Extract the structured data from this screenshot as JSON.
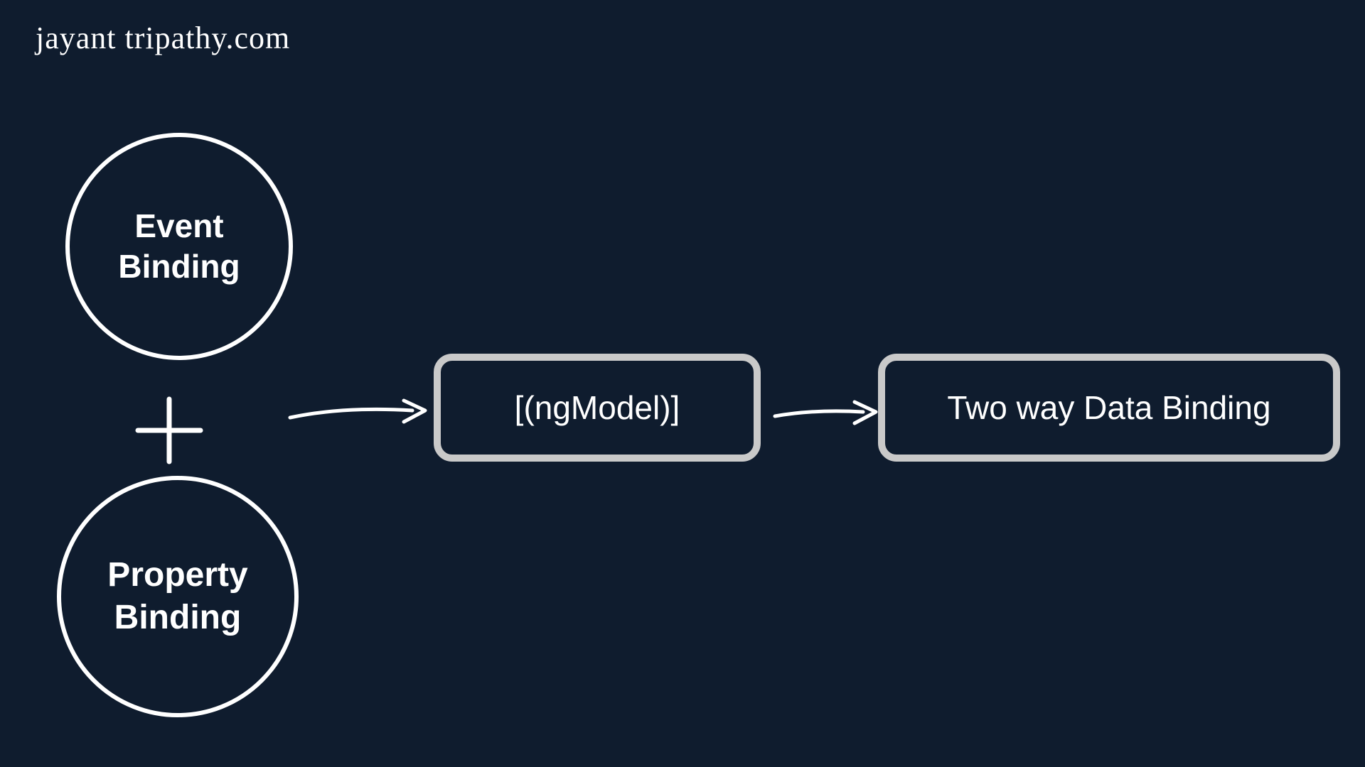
{
  "watermark": "jayant tripathy.com",
  "circles": {
    "top": {
      "line1": "Event",
      "line2": "Binding"
    },
    "bottom": {
      "line1": "Property",
      "line2": "Binding"
    }
  },
  "boxes": {
    "ngmodel": "[(ngModel)]",
    "twoway": "Two way Data Binding"
  },
  "colors": {
    "background": "#0f1c2e",
    "stroke": "#ffffff",
    "boxBorder": "#c9c9c9"
  }
}
